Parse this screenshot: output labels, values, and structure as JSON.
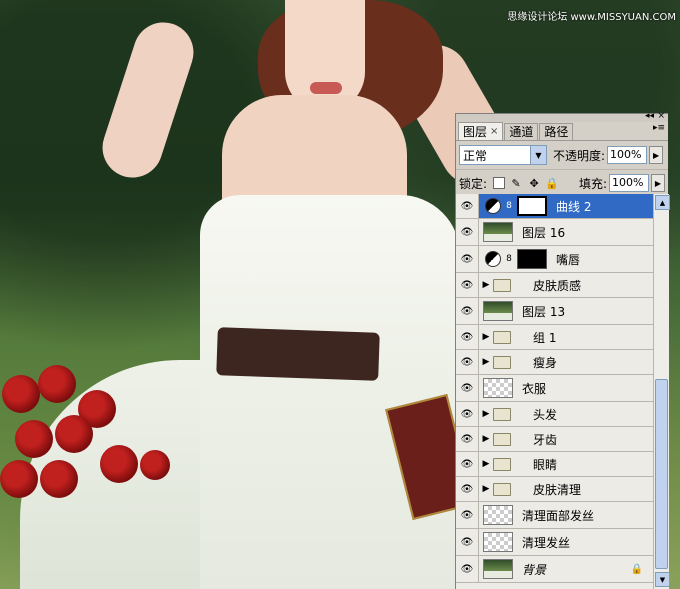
{
  "watermark": "思缘设计论坛 www.MISSYUAN.COM",
  "panel": {
    "controls": {
      "minimize": "◂◂",
      "close": "×"
    },
    "tabs": [
      {
        "label": "图层",
        "active": true,
        "close": "×"
      },
      {
        "label": "通道",
        "active": false
      },
      {
        "label": "路径",
        "active": false
      }
    ],
    "menu_icon": "▸≡",
    "blend_mode": "正常",
    "opacity_label": "不透明度:",
    "opacity_value": "100%",
    "lock_label": "锁定:",
    "fill_label": "填充:",
    "fill_value": "100%"
  },
  "layers": [
    {
      "name": "曲线 2",
      "kind": "adjustment",
      "selected": true
    },
    {
      "name": "图层 16",
      "kind": "image"
    },
    {
      "name": "嘴唇",
      "kind": "adjustment-black"
    },
    {
      "name": "皮肤质感",
      "kind": "group"
    },
    {
      "name": "图层 13",
      "kind": "image"
    },
    {
      "name": "组 1",
      "kind": "group"
    },
    {
      "name": "瘦身",
      "kind": "group"
    },
    {
      "name": "衣服",
      "kind": "transparent"
    },
    {
      "name": "头发",
      "kind": "group"
    },
    {
      "name": "牙齿",
      "kind": "group"
    },
    {
      "name": "眼睛",
      "kind": "group"
    },
    {
      "name": "皮肤清理",
      "kind": "group"
    },
    {
      "name": "清理面部发丝",
      "kind": "transparent"
    },
    {
      "name": "清理发丝",
      "kind": "transparent"
    },
    {
      "name": "背景",
      "kind": "background"
    }
  ],
  "colors": {
    "selection": "#316ac5",
    "panel": "#d4d0c8"
  },
  "icons": {
    "visibility": "eye-icon",
    "lock": "lock-icon",
    "folder": "folder-icon",
    "expand": "triangle-right-icon"
  }
}
